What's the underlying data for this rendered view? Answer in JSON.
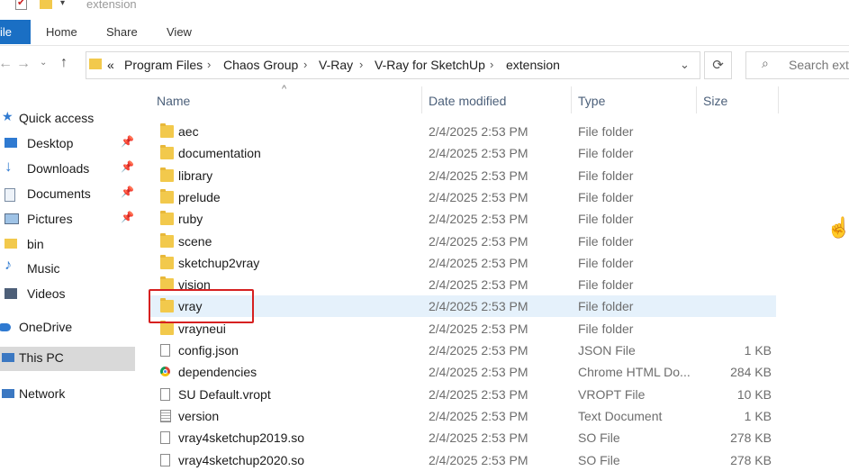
{
  "window": {
    "title": "extension"
  },
  "ribbon": {
    "file": "ile",
    "tabs": [
      "Home",
      "Share",
      "View"
    ]
  },
  "address": {
    "prefix": "«",
    "crumbs": [
      "Program Files",
      "Chaos Group",
      "V-Ray",
      "V-Ray for SketchUp",
      "extension"
    ],
    "refresh_icon": "⟳",
    "search_placeholder": "Search exte"
  },
  "nav": {
    "quick_access": "Quick access",
    "items": [
      {
        "label": "Desktop",
        "icon": "desktop-icon",
        "pinned": true
      },
      {
        "label": "Downloads",
        "icon": "downloads-icon",
        "pinned": true
      },
      {
        "label": "Documents",
        "icon": "documents-icon",
        "pinned": true
      },
      {
        "label": "Pictures",
        "icon": "pictures-icon",
        "pinned": true
      },
      {
        "label": "bin",
        "icon": "folder-icon",
        "pinned": false
      },
      {
        "label": "Music",
        "icon": "music-icon",
        "pinned": false
      },
      {
        "label": "Videos",
        "icon": "videos-icon",
        "pinned": false
      }
    ],
    "onedrive": "OneDrive",
    "this_pc": "This PC",
    "network": "Network"
  },
  "columns": {
    "name": "Name",
    "date": "Date modified",
    "type": "Type",
    "size": "Size"
  },
  "files": [
    {
      "name": "aec",
      "date": "2/4/2025 2:53 PM",
      "type": "File folder",
      "size": "",
      "icon": "folder"
    },
    {
      "name": "documentation",
      "date": "2/4/2025 2:53 PM",
      "type": "File folder",
      "size": "",
      "icon": "folder"
    },
    {
      "name": "library",
      "date": "2/4/2025 2:53 PM",
      "type": "File folder",
      "size": "",
      "icon": "folder"
    },
    {
      "name": "prelude",
      "date": "2/4/2025 2:53 PM",
      "type": "File folder",
      "size": "",
      "icon": "folder"
    },
    {
      "name": "ruby",
      "date": "2/4/2025 2:53 PM",
      "type": "File folder",
      "size": "",
      "icon": "folder"
    },
    {
      "name": "scene",
      "date": "2/4/2025 2:53 PM",
      "type": "File folder",
      "size": "",
      "icon": "folder"
    },
    {
      "name": "sketchup2vray",
      "date": "2/4/2025 2:53 PM",
      "type": "File folder",
      "size": "",
      "icon": "folder"
    },
    {
      "name": "vision",
      "date": "2/4/2025 2:53 PM",
      "type": "File folder",
      "size": "",
      "icon": "folder"
    },
    {
      "name": "vray",
      "date": "2/4/2025 2:53 PM",
      "type": "File folder",
      "size": "",
      "icon": "folder",
      "selected": true
    },
    {
      "name": "vrayneui",
      "date": "2/4/2025 2:53 PM",
      "type": "File folder",
      "size": "",
      "icon": "folder"
    },
    {
      "name": "config.json",
      "date": "2/4/2025 2:53 PM",
      "type": "JSON File",
      "size": "1 KB",
      "icon": "doc"
    },
    {
      "name": "dependencies",
      "date": "2/4/2025 2:53 PM",
      "type": "Chrome HTML Do...",
      "size": "284 KB",
      "icon": "chrome"
    },
    {
      "name": "SU Default.vropt",
      "date": "2/4/2025 2:53 PM",
      "type": "VROPT File",
      "size": "10 KB",
      "icon": "doc"
    },
    {
      "name": "version",
      "date": "2/4/2025 2:53 PM",
      "type": "Text Document",
      "size": "1 KB",
      "icon": "txt"
    },
    {
      "name": "vray4sketchup2019.so",
      "date": "2/4/2025 2:53 PM",
      "type": "SO File",
      "size": "278 KB",
      "icon": "doc"
    },
    {
      "name": "vray4sketchup2020.so",
      "date": "2/4/2025 2:53 PM",
      "type": "SO File",
      "size": "278 KB",
      "icon": "doc"
    }
  ],
  "colors": {
    "accent": "#1a6fc4",
    "selection": "#e5f1fb",
    "highlight": "#d62020"
  }
}
